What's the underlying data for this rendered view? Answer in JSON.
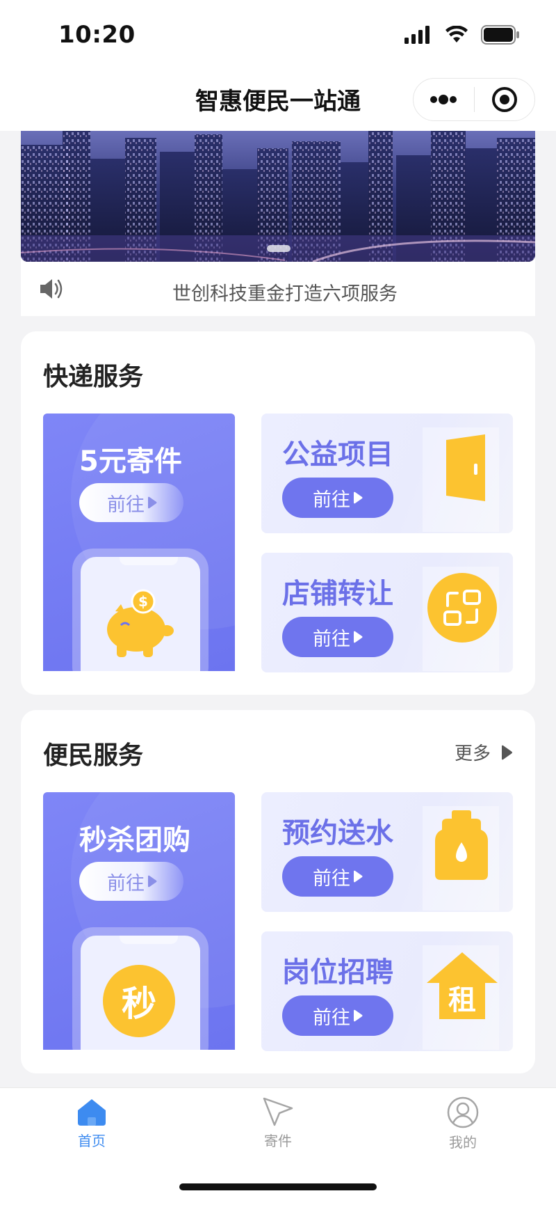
{
  "status_bar": {
    "time": "10:20"
  },
  "navbar": {
    "title": "智惠便民一站通"
  },
  "notice": {
    "text": "世创科技重金打造六项服务"
  },
  "express": {
    "title": "快递服务",
    "big": {
      "title": "5元寄件",
      "button": "前往"
    },
    "items": [
      {
        "title": "公益项目",
        "button": "前往",
        "icon": "door-icon"
      },
      {
        "title": "店铺转让",
        "button": "前往",
        "icon": "transfer-icon"
      }
    ]
  },
  "convenience": {
    "title": "便民服务",
    "more": "更多",
    "big": {
      "title": "秒杀团购",
      "button": "前往",
      "badge": "秒"
    },
    "items": [
      {
        "title": "预约送水",
        "button": "前往",
        "icon": "water-bottle-icon"
      },
      {
        "title": "岗位招聘",
        "button": "前往",
        "icon": "house-icon",
        "icon_text": "租"
      }
    ]
  },
  "tabbar": {
    "items": [
      {
        "label": "首页",
        "icon": "home-icon",
        "active": true
      },
      {
        "label": "寄件",
        "icon": "send-icon",
        "active": false
      },
      {
        "label": "我的",
        "icon": "profile-icon",
        "active": false
      }
    ]
  },
  "colors": {
    "accent": "#6f75ee",
    "yellow": "#fcc330",
    "tab_active": "#3d8bf0"
  }
}
